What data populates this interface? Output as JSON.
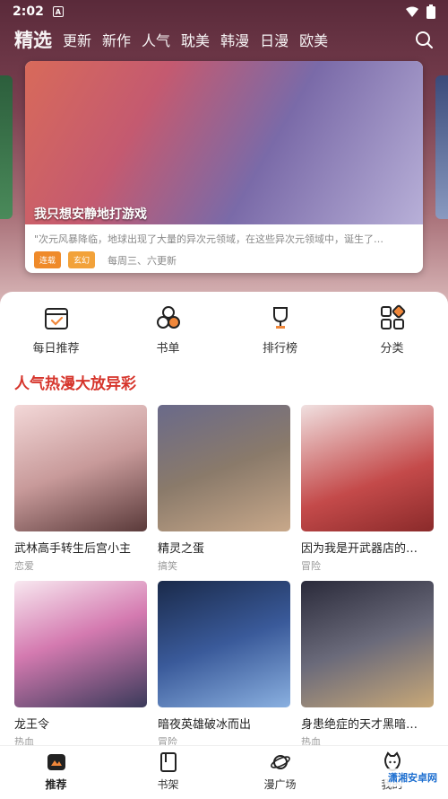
{
  "status_bar": {
    "time": "2:02",
    "notification_glyph": "A"
  },
  "top_nav": {
    "tabs": [
      {
        "label": "精选",
        "active": true
      },
      {
        "label": "更新"
      },
      {
        "label": "新作"
      },
      {
        "label": "人气"
      },
      {
        "label": "耽美"
      },
      {
        "label": "韩漫"
      },
      {
        "label": "日漫"
      },
      {
        "label": "欧美"
      }
    ],
    "search_icon": "search-icon"
  },
  "banner": {
    "title": "我只想安静地打游戏",
    "description": "\"次元风暴降临，地球出现了大量的异次元领域，在这些异次元领域中，诞生了…",
    "tags": [
      "连载",
      "玄幻"
    ],
    "schedule": "每周三、六更新"
  },
  "quick_links": [
    {
      "label": "每日推荐",
      "icon": "calendar-check-icon"
    },
    {
      "label": "书单",
      "icon": "circles-icon"
    },
    {
      "label": "排行榜",
      "icon": "trophy-icon"
    },
    {
      "label": "分类",
      "icon": "category-icon"
    }
  ],
  "section": {
    "title": "人气热漫大放异彩"
  },
  "comics": [
    {
      "name": "武林高手转生后宫小主",
      "genre": "恋爱"
    },
    {
      "name": "精灵之蛋",
      "genre": "搞笑"
    },
    {
      "name": "因为我是开武器店的…",
      "genre": "冒险"
    },
    {
      "name": "龙王令",
      "genre": "热血"
    },
    {
      "name": "暗夜英雄破冰而出",
      "genre": "冒险"
    },
    {
      "name": "身患绝症的天才黑暗…",
      "genre": "热血"
    }
  ],
  "bottom_nav": [
    {
      "label": "推荐",
      "icon": "recommend-icon",
      "active": true
    },
    {
      "label": "书架",
      "icon": "bookshelf-icon"
    },
    {
      "label": "漫广场",
      "icon": "planet-icon"
    },
    {
      "label": "我的",
      "icon": "profile-icon"
    }
  ],
  "watermark": "潇湘安卓网",
  "colors": {
    "accent": "#d6352c",
    "tag_serial": "#ef8a2a",
    "tag_genre": "#f2a23a"
  }
}
